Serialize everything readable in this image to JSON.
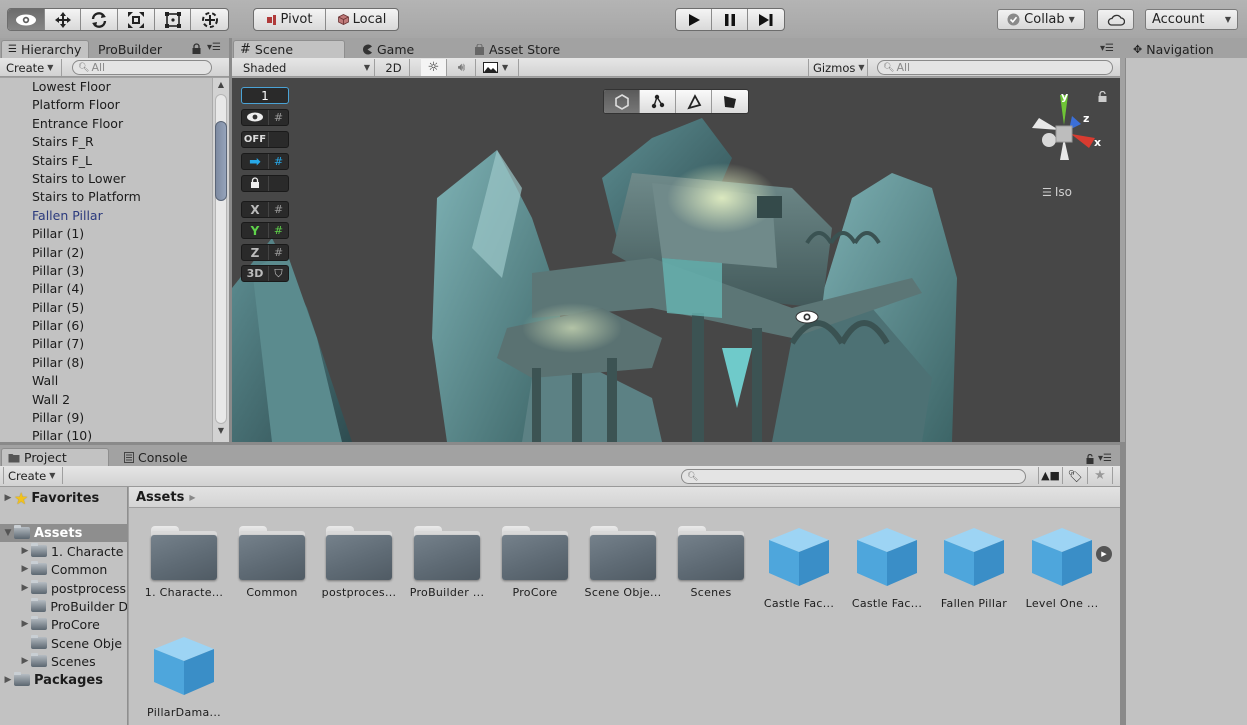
{
  "toolbar": {
    "tools": [
      {
        "name": "view-tool",
        "icon": "eye-icon",
        "glyph": "👁",
        "active": true
      },
      {
        "name": "move-tool",
        "icon": "move-arrows-icon",
        "glyph": "✥",
        "active": false
      },
      {
        "name": "rotate-tool",
        "icon": "rotate-icon",
        "glyph": "⟳",
        "active": false
      },
      {
        "name": "scale-tool",
        "icon": "scale-icon",
        "glyph": "⤧",
        "active": false
      },
      {
        "name": "rect-tool",
        "icon": "rect-transform-icon",
        "glyph": "▣",
        "active": false
      },
      {
        "name": "transform-tool",
        "icon": "transform-icon",
        "glyph": "⊕",
        "active": false
      }
    ],
    "pivot_label": "Pivot",
    "local_label": "Local",
    "play_glyph": "▶",
    "pause_glyph": "❚❚",
    "step_glyph": "▶❙",
    "collab_label": "Collab",
    "account_label": "Account"
  },
  "hierarchy": {
    "tab_label": "Hierarchy",
    "probuilder_tab_label": "ProBuilder",
    "create_label": "Create",
    "search_placeholder": "All",
    "items": [
      {
        "label": "Lowest Floor",
        "prefab": false
      },
      {
        "label": "Platform Floor",
        "prefab": false
      },
      {
        "label": "Entrance  Floor",
        "prefab": false
      },
      {
        "label": "Stairs F_R",
        "prefab": false
      },
      {
        "label": "Stairs F_L",
        "prefab": false
      },
      {
        "label": "Stairs to Lower",
        "prefab": false
      },
      {
        "label": "Stairs to Platform",
        "prefab": false
      },
      {
        "label": "Fallen Pillar",
        "prefab": true
      },
      {
        "label": "Pillar (1)",
        "prefab": false
      },
      {
        "label": "Pillar (2)",
        "prefab": false
      },
      {
        "label": "Pillar (3)",
        "prefab": false
      },
      {
        "label": "Pillar (4)",
        "prefab": false
      },
      {
        "label": "Pillar (5)",
        "prefab": false
      },
      {
        "label": "Pillar (6)",
        "prefab": false
      },
      {
        "label": "Pillar (7)",
        "prefab": false
      },
      {
        "label": "Pillar (8)",
        "prefab": false
      },
      {
        "label": "Wall",
        "prefab": false
      },
      {
        "label": "Wall 2",
        "prefab": false
      },
      {
        "label": "Pillar (9)",
        "prefab": false
      },
      {
        "label": "Pillar (10)",
        "prefab": false
      }
    ]
  },
  "scene": {
    "tabs": [
      {
        "label": "Scene",
        "icon": "grid-hash-icon",
        "glyph": "#",
        "active": true
      },
      {
        "label": "Game",
        "icon": "pacman-icon",
        "glyph": "◖",
        "active": false
      },
      {
        "label": "Asset Store",
        "icon": "shopping-bag-icon",
        "glyph": "🛍",
        "active": false
      }
    ],
    "shading_mode": "Shaded",
    "mode_2d_label": "2D",
    "gizmos_label": "Gizmos",
    "search_placeholder": "All",
    "overlay": {
      "grid_size_value": "1",
      "off_label": "OFF",
      "x_label": "X",
      "y_label": "Y",
      "z_label": "Z",
      "threed_label": "3D"
    },
    "axis_labels": {
      "y": "y",
      "z": "z",
      "x": "x"
    },
    "projection_label": "Iso"
  },
  "navigation": {
    "tab_label": "Navigation"
  },
  "project": {
    "tab_label": "Project",
    "console_tab_label": "Console",
    "create_label": "Create",
    "search_placeholder": "",
    "breadcrumb": "Assets",
    "tree": [
      {
        "label": "Favorites",
        "level": 0,
        "bold": true,
        "icon": "star-icon",
        "expanded": false,
        "has_children": true,
        "selected": false
      },
      {
        "label": "Assets",
        "level": 0,
        "bold": true,
        "icon": "folder-icon",
        "expanded": true,
        "has_children": true,
        "selected": true
      },
      {
        "label": "1. Characte",
        "level": 1,
        "bold": false,
        "icon": "folder-icon",
        "expanded": false,
        "has_children": true,
        "selected": false
      },
      {
        "label": "Common",
        "level": 1,
        "bold": false,
        "icon": "folder-icon",
        "expanded": false,
        "has_children": true,
        "selected": false
      },
      {
        "label": "postprocess",
        "level": 1,
        "bold": false,
        "icon": "folder-icon",
        "expanded": false,
        "has_children": true,
        "selected": false
      },
      {
        "label": "ProBuilder D",
        "level": 1,
        "bold": false,
        "icon": "folder-icon",
        "expanded": false,
        "has_children": false,
        "selected": false
      },
      {
        "label": "ProCore",
        "level": 1,
        "bold": false,
        "icon": "folder-icon",
        "expanded": false,
        "has_children": true,
        "selected": false
      },
      {
        "label": "Scene Obje",
        "level": 1,
        "bold": false,
        "icon": "folder-icon",
        "expanded": false,
        "has_children": false,
        "selected": false
      },
      {
        "label": "Scenes",
        "level": 1,
        "bold": false,
        "icon": "folder-icon",
        "expanded": false,
        "has_children": true,
        "selected": false
      },
      {
        "label": "Packages",
        "level": 0,
        "bold": true,
        "icon": "folder-icon",
        "expanded": false,
        "has_children": true,
        "selected": false
      }
    ],
    "assets": [
      {
        "label": "1. Characte...",
        "type": "folder"
      },
      {
        "label": "Common",
        "type": "folder"
      },
      {
        "label": "postproces...",
        "type": "folder"
      },
      {
        "label": "ProBuilder ...",
        "type": "folder"
      },
      {
        "label": "ProCore",
        "type": "folder"
      },
      {
        "label": "Scene Obje...",
        "type": "folder"
      },
      {
        "label": "Scenes",
        "type": "folder"
      },
      {
        "label": "Castle Fac...",
        "type": "prefab"
      },
      {
        "label": "Castle Fac...",
        "type": "prefab"
      },
      {
        "label": "Fallen Pillar",
        "type": "prefab"
      },
      {
        "label": "Level One ...",
        "type": "prefab"
      },
      {
        "label": "PillarDama...",
        "type": "prefab"
      }
    ]
  },
  "colors": {
    "editor_bg": "#a2a2a2",
    "panel_bg": "#c2c2c2",
    "scene_bg": "#474747",
    "prefab_text": "#2b3a7d",
    "axis_y": "#6fc436",
    "axis_z": "#3b6fd8",
    "axis_x": "#d83b30",
    "snap_blue": "#27a8e8"
  }
}
